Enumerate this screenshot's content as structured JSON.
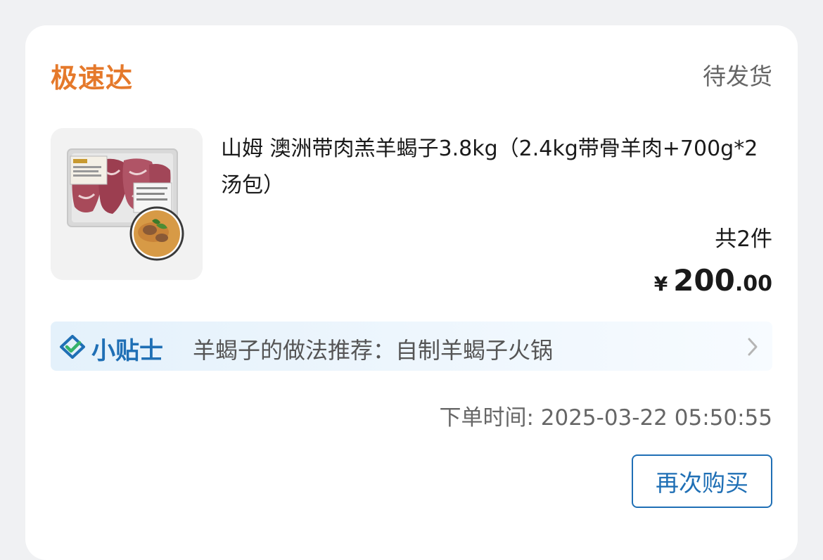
{
  "order": {
    "store_name": "极速达",
    "status": "待发货",
    "product": {
      "title": "山姆 澳洲带肉羔羊蝎子3.8kg（2.4kg带骨羊肉+700g*2汤包）",
      "thumbnail_icon": "lamb-product-image",
      "quantity_text": "共2件",
      "price": {
        "currency": "¥",
        "integer": "200",
        "decimal": ".00"
      }
    },
    "tips": {
      "icon": "check-shield-icon",
      "label": "小贴士",
      "text": "羊蝎子的做法推荐：自制羊蝎子火锅",
      "chevron_icon": "chevron-right-icon"
    },
    "order_time": "下单时间: 2025-03-22 05:50:55",
    "rebuy_label": "再次购买"
  },
  "colors": {
    "store_name": "#e5792b",
    "accent_blue": "#1f6fb5",
    "card_bg": "#ffffff",
    "page_bg": "#f0f1f3"
  }
}
